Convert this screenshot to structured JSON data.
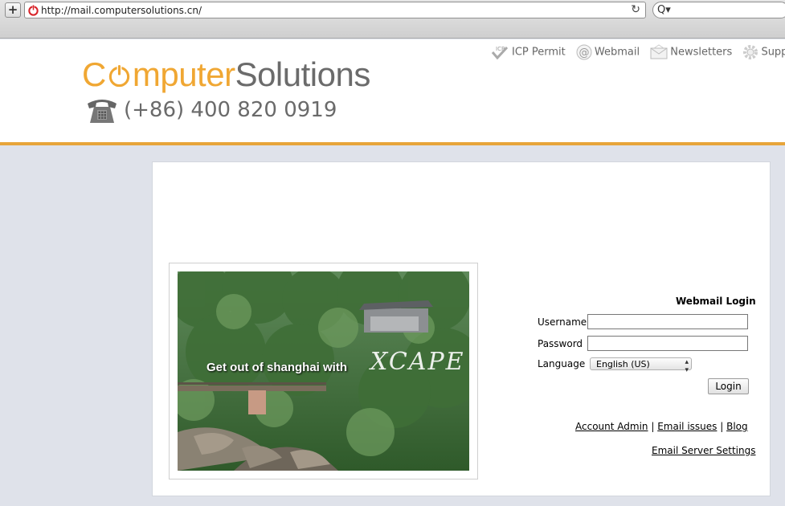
{
  "browser": {
    "url": "http://mail.computersolutions.cn/",
    "new_tab_symbol": "+",
    "reload_symbol": "↻",
    "search_symbol": "Q▾"
  },
  "header": {
    "logo_part1": "C",
    "logo_part2": "mputer",
    "logo_part3": "Solutions",
    "phone": "(+86) 400 820 0919",
    "colors": {
      "accent": "#f0a733",
      "logo_gray": "#6b6b6b",
      "rule": "#e7a53a"
    },
    "nav": [
      {
        "label": "ICP Permit",
        "icon": "icp-check-icon"
      },
      {
        "label": "Webmail",
        "icon": "at-icon"
      },
      {
        "label": "Newsletters",
        "icon": "envelope-icon"
      },
      {
        "label": "Suppo",
        "icon": "gear-icon"
      }
    ]
  },
  "promo": {
    "text": "Get out of shanghai with",
    "brand": "XCAPE"
  },
  "login": {
    "title": "Webmail Login",
    "username_label": "Username",
    "password_label": "Password",
    "language_label": "Language",
    "language_value": "English (US)",
    "submit_label": "Login",
    "links": [
      "Account Admin",
      "Email issues",
      "Blog"
    ],
    "separator": "|",
    "server_settings": "Email Server Settings"
  }
}
